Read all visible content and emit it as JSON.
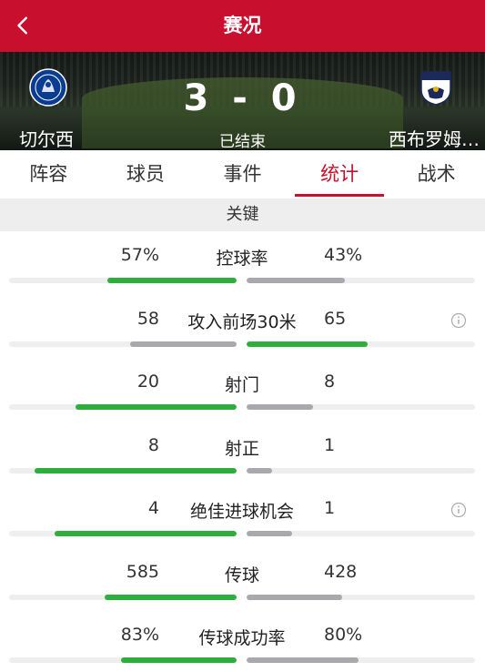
{
  "topbar": {
    "title": "赛况"
  },
  "match": {
    "home": {
      "name": "切尔西",
      "logo_icon": "chelsea-crest"
    },
    "away": {
      "name": "西布罗姆…",
      "logo_icon": "west-brom-crest"
    },
    "score": "3 - 0",
    "status": "已结束"
  },
  "tabs": [
    {
      "label": "阵容",
      "active": false
    },
    {
      "label": "球员",
      "active": false
    },
    {
      "label": "事件",
      "active": false
    },
    {
      "label": "统计",
      "active": true
    },
    {
      "label": "战术",
      "active": false
    }
  ],
  "section": {
    "title": "关键"
  },
  "colors": {
    "accent": "#c8102e",
    "leader_bar": "#2eae3d",
    "trailer_bar": "#a8a8ad"
  },
  "stats": [
    {
      "label": "控球率",
      "home": "57%",
      "away": "43%",
      "home_share": 0.57,
      "away_share": 0.43,
      "leader": "home",
      "info": false
    },
    {
      "label": "攻入前场30米",
      "home": "58",
      "away": "65",
      "home_share": 0.47,
      "away_share": 0.53,
      "leader": "away",
      "info": true
    },
    {
      "label": "射门",
      "home": "20",
      "away": "8",
      "home_share": 0.71,
      "away_share": 0.29,
      "leader": "home",
      "info": false
    },
    {
      "label": "射正",
      "home": "8",
      "away": "1",
      "home_share": 0.89,
      "away_share": 0.11,
      "leader": "home",
      "info": false
    },
    {
      "label": "绝佳进球机会",
      "home": "4",
      "away": "1",
      "home_share": 0.8,
      "away_share": 0.2,
      "leader": "home",
      "info": true
    },
    {
      "label": "传球",
      "home": "585",
      "away": "428",
      "home_share": 0.58,
      "away_share": 0.42,
      "leader": "home",
      "info": false
    },
    {
      "label": "传球成功率",
      "home": "83%",
      "away": "80%",
      "home_share": 0.51,
      "away_share": 0.49,
      "leader": "home",
      "info": false
    }
  ]
}
